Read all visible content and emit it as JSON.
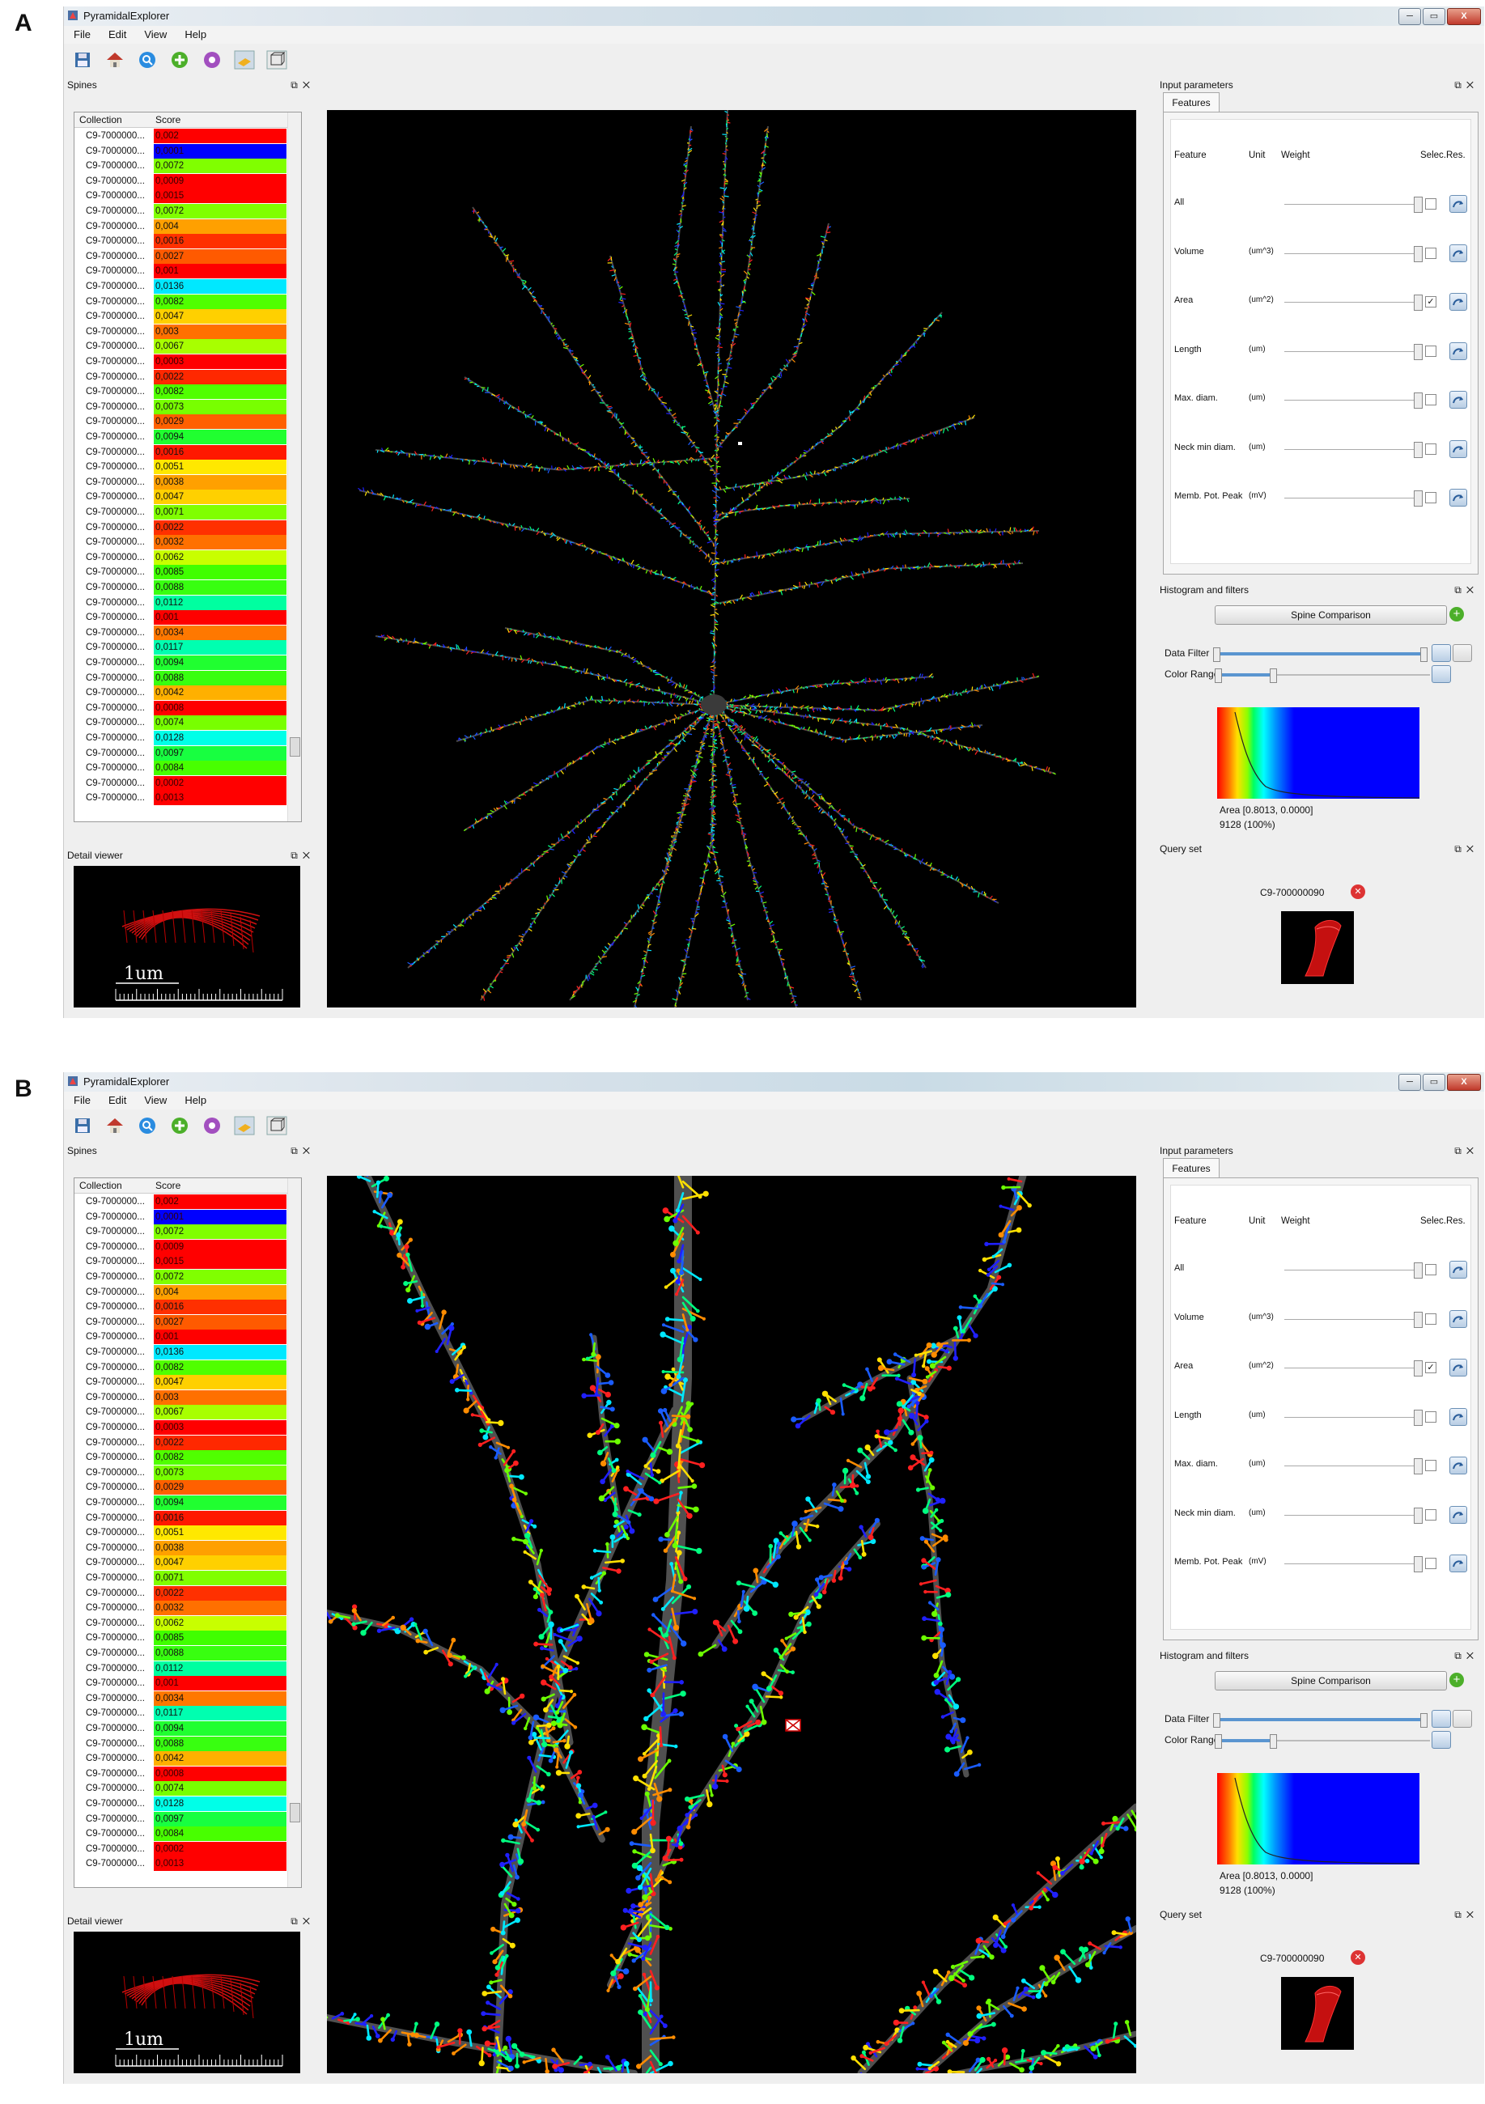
{
  "panels": [
    {
      "letter": "A",
      "window": {
        "title": "PyramidalExplorer",
        "buttons": [
          "─",
          "▭",
          "X"
        ]
      },
      "menu": [
        "File",
        "Edit",
        "View",
        "Help"
      ],
      "spines": {
        "header": "Spines",
        "columns": [
          "Collection",
          "Score"
        ],
        "rows": [
          {
            "c": "C9-7000000...",
            "v": "0,002",
            "color": "#ff0000"
          },
          {
            "c": "C9-7000000...",
            "v": "0,0001",
            "color": "#0000ff"
          },
          {
            "c": "C9-7000000...",
            "v": "0,0072",
            "color": "#80ff00"
          },
          {
            "c": "C9-7000000...",
            "v": "0,0009",
            "color": "#ff0000"
          },
          {
            "c": "C9-7000000...",
            "v": "0,0015",
            "color": "#ff0000"
          },
          {
            "c": "C9-7000000...",
            "v": "0,0072",
            "color": "#80ff00"
          },
          {
            "c": "C9-7000000...",
            "v": "0,004",
            "color": "#ffa000"
          },
          {
            "c": "C9-7000000...",
            "v": "0,0016",
            "color": "#ff3000"
          },
          {
            "c": "C9-7000000...",
            "v": "0,0027",
            "color": "#ff5a00"
          },
          {
            "c": "C9-7000000...",
            "v": "0,001",
            "color": "#ff0000"
          },
          {
            "c": "C9-7000000...",
            "v": "0,0136",
            "color": "#00e8ff"
          },
          {
            "c": "C9-7000000...",
            "v": "0,0082",
            "color": "#50ff00"
          },
          {
            "c": "C9-7000000...",
            "v": "0,0047",
            "color": "#ffd000"
          },
          {
            "c": "C9-7000000...",
            "v": "0,003",
            "color": "#ff7000"
          },
          {
            "c": "C9-7000000...",
            "v": "0,0067",
            "color": "#a8ff00"
          },
          {
            "c": "C9-7000000...",
            "v": "0,0003",
            "color": "#ff0000"
          },
          {
            "c": "C9-7000000...",
            "v": "0,0022",
            "color": "#ff2800"
          },
          {
            "c": "C9-7000000...",
            "v": "0,0082",
            "color": "#50ff00"
          },
          {
            "c": "C9-7000000...",
            "v": "0,0073",
            "color": "#78ff00"
          },
          {
            "c": "C9-7000000...",
            "v": "0,0029",
            "color": "#ff6000"
          },
          {
            "c": "C9-7000000...",
            "v": "0,0094",
            "color": "#20ff30"
          },
          {
            "c": "C9-7000000...",
            "v": "0,0016",
            "color": "#ff1800"
          },
          {
            "c": "C9-7000000...",
            "v": "0,0051",
            "color": "#ffe800"
          },
          {
            "c": "C9-7000000...",
            "v": "0,0038",
            "color": "#ffa000"
          },
          {
            "c": "C9-7000000...",
            "v": "0,0047",
            "color": "#ffd000"
          },
          {
            "c": "C9-7000000...",
            "v": "0,0071",
            "color": "#80ff00"
          },
          {
            "c": "C9-7000000...",
            "v": "0,0022",
            "color": "#ff3000"
          },
          {
            "c": "C9-7000000...",
            "v": "0,0032",
            "color": "#ff7000"
          },
          {
            "c": "C9-7000000...",
            "v": "0,0062",
            "color": "#c8ff00"
          },
          {
            "c": "C9-7000000...",
            "v": "0,0085",
            "color": "#40ff00"
          },
          {
            "c": "C9-7000000...",
            "v": "0,0088",
            "color": "#38ff10"
          },
          {
            "c": "C9-7000000...",
            "v": "0,0112",
            "color": "#00ffa0"
          },
          {
            "c": "C9-7000000...",
            "v": "0,001",
            "color": "#ff0000"
          },
          {
            "c": "C9-7000000...",
            "v": "0,0034",
            "color": "#ff7800"
          },
          {
            "c": "C9-7000000...",
            "v": "0,0117",
            "color": "#00ffb0"
          },
          {
            "c": "C9-7000000...",
            "v": "0,0094",
            "color": "#20ff30"
          },
          {
            "c": "C9-7000000...",
            "v": "0,0088",
            "color": "#38ff10"
          },
          {
            "c": "C9-7000000...",
            "v": "0,0042",
            "color": "#ffb000"
          },
          {
            "c": "C9-7000000...",
            "v": "0,0008",
            "color": "#ff0000"
          },
          {
            "c": "C9-7000000...",
            "v": "0,0074",
            "color": "#78ff00"
          },
          {
            "c": "C9-7000000...",
            "v": "0,0128",
            "color": "#00ffe8"
          },
          {
            "c": "C9-7000000...",
            "v": "0,0097",
            "color": "#18ff40"
          },
          {
            "c": "C9-7000000...",
            "v": "0,0084",
            "color": "#48ff00"
          },
          {
            "c": "C9-7000000...",
            "v": "0,0002",
            "color": "#ff0000"
          },
          {
            "c": "C9-7000000...",
            "v": "0,0013",
            "color": "#ff0000"
          }
        ]
      },
      "detail": {
        "header": "Detail viewer",
        "scale": "1um"
      },
      "input": {
        "header": "Input parameters",
        "tab": "Features",
        "cols": [
          "Feature",
          "Unit",
          "Weight",
          "Selec.",
          "Res."
        ],
        "features": [
          {
            "name": "All",
            "unit": "",
            "checked": false
          },
          {
            "name": "Volume",
            "unit": "(um^3)",
            "checked": false
          },
          {
            "name": "Area",
            "unit": "(um^2)",
            "checked": true
          },
          {
            "name": "Length",
            "unit": "(um)",
            "checked": false
          },
          {
            "name": "Max. diam.",
            "unit": "(um)",
            "checked": false
          },
          {
            "name": "Neck min diam.",
            "unit": "(um)",
            "checked": false
          },
          {
            "name": "Memb. Pot. Peak",
            "unit": "(mV)",
            "checked": false
          }
        ]
      },
      "histogram": {
        "header": "Histogram and filters",
        "button": "Spine Comparison",
        "data_filter": "Data Filter",
        "color_range": "Color Range",
        "caption1": "Area [0.8013, 0.0000]",
        "caption2": "9128 (100%)"
      },
      "query": {
        "header": "Query set",
        "id": "C9-700000090"
      },
      "zoom": false
    },
    {
      "letter": "B",
      "window": {
        "title": "PyramidalExplorer",
        "buttons": [
          "─",
          "▭",
          "X"
        ]
      },
      "menu": [
        "File",
        "Edit",
        "View",
        "Help"
      ],
      "spines": {
        "header": "Spines",
        "columns": [
          "Collection",
          "Score"
        ],
        "rows": [
          {
            "c": "C9-7000000...",
            "v": "0,002",
            "color": "#ff0000"
          },
          {
            "c": "C9-7000000...",
            "v": "0,0001",
            "color": "#0000ff"
          },
          {
            "c": "C9-7000000...",
            "v": "0,0072",
            "color": "#80ff00"
          },
          {
            "c": "C9-7000000...",
            "v": "0,0009",
            "color": "#ff0000"
          },
          {
            "c": "C9-7000000...",
            "v": "0,0015",
            "color": "#ff0000"
          },
          {
            "c": "C9-7000000...",
            "v": "0,0072",
            "color": "#80ff00"
          },
          {
            "c": "C9-7000000...",
            "v": "0,004",
            "color": "#ffa000"
          },
          {
            "c": "C9-7000000...",
            "v": "0,0016",
            "color": "#ff3000"
          },
          {
            "c": "C9-7000000...",
            "v": "0,0027",
            "color": "#ff5a00"
          },
          {
            "c": "C9-7000000...",
            "v": "0,001",
            "color": "#ff0000"
          },
          {
            "c": "C9-7000000...",
            "v": "0,0136",
            "color": "#00e8ff"
          },
          {
            "c": "C9-7000000...",
            "v": "0,0082",
            "color": "#50ff00"
          },
          {
            "c": "C9-7000000...",
            "v": "0,0047",
            "color": "#ffd000"
          },
          {
            "c": "C9-7000000...",
            "v": "0,003",
            "color": "#ff7000"
          },
          {
            "c": "C9-7000000...",
            "v": "0,0067",
            "color": "#a8ff00"
          },
          {
            "c": "C9-7000000...",
            "v": "0,0003",
            "color": "#ff0000"
          },
          {
            "c": "C9-7000000...",
            "v": "0,0022",
            "color": "#ff2800"
          },
          {
            "c": "C9-7000000...",
            "v": "0,0082",
            "color": "#50ff00"
          },
          {
            "c": "C9-7000000...",
            "v": "0,0073",
            "color": "#78ff00"
          },
          {
            "c": "C9-7000000...",
            "v": "0,0029",
            "color": "#ff6000"
          },
          {
            "c": "C9-7000000...",
            "v": "0,0094",
            "color": "#20ff30"
          },
          {
            "c": "C9-7000000...",
            "v": "0,0016",
            "color": "#ff1800"
          },
          {
            "c": "C9-7000000...",
            "v": "0,0051",
            "color": "#ffe800"
          },
          {
            "c": "C9-7000000...",
            "v": "0,0038",
            "color": "#ffa000"
          },
          {
            "c": "C9-7000000...",
            "v": "0,0047",
            "color": "#ffd000"
          },
          {
            "c": "C9-7000000...",
            "v": "0,0071",
            "color": "#80ff00"
          },
          {
            "c": "C9-7000000...",
            "v": "0,0022",
            "color": "#ff3000"
          },
          {
            "c": "C9-7000000...",
            "v": "0,0032",
            "color": "#ff7000"
          },
          {
            "c": "C9-7000000...",
            "v": "0,0062",
            "color": "#c8ff00"
          },
          {
            "c": "C9-7000000...",
            "v": "0,0085",
            "color": "#40ff00"
          },
          {
            "c": "C9-7000000...",
            "v": "0,0088",
            "color": "#38ff10"
          },
          {
            "c": "C9-7000000...",
            "v": "0,0112",
            "color": "#00ffa0"
          },
          {
            "c": "C9-7000000...",
            "v": "0,001",
            "color": "#ff0000"
          },
          {
            "c": "C9-7000000...",
            "v": "0,0034",
            "color": "#ff7800"
          },
          {
            "c": "C9-7000000...",
            "v": "0,0117",
            "color": "#00ffb0"
          },
          {
            "c": "C9-7000000...",
            "v": "0,0094",
            "color": "#20ff30"
          },
          {
            "c": "C9-7000000...",
            "v": "0,0088",
            "color": "#38ff10"
          },
          {
            "c": "C9-7000000...",
            "v": "0,0042",
            "color": "#ffb000"
          },
          {
            "c": "C9-7000000...",
            "v": "0,0008",
            "color": "#ff0000"
          },
          {
            "c": "C9-7000000...",
            "v": "0,0074",
            "color": "#78ff00"
          },
          {
            "c": "C9-7000000...",
            "v": "0,0128",
            "color": "#00ffe8"
          },
          {
            "c": "C9-7000000...",
            "v": "0,0097",
            "color": "#18ff40"
          },
          {
            "c": "C9-7000000...",
            "v": "0,0084",
            "color": "#48ff00"
          },
          {
            "c": "C9-7000000...",
            "v": "0,0002",
            "color": "#ff0000"
          },
          {
            "c": "C9-7000000...",
            "v": "0,0013",
            "color": "#ff0000"
          }
        ]
      },
      "detail": {
        "header": "Detail viewer",
        "scale": "1um"
      },
      "input": {
        "header": "Input parameters",
        "tab": "Features",
        "cols": [
          "Feature",
          "Unit",
          "Weight",
          "Selec.",
          "Res."
        ],
        "features": [
          {
            "name": "All",
            "unit": "",
            "checked": false
          },
          {
            "name": "Volume",
            "unit": "(um^3)",
            "checked": false
          },
          {
            "name": "Area",
            "unit": "(um^2)",
            "checked": true
          },
          {
            "name": "Length",
            "unit": "(um)",
            "checked": false
          },
          {
            "name": "Max. diam.",
            "unit": "(um)",
            "checked": false
          },
          {
            "name": "Neck min diam.",
            "unit": "(um)",
            "checked": false
          },
          {
            "name": "Memb. Pot. Peak",
            "unit": "(mV)",
            "checked": false
          }
        ]
      },
      "histogram": {
        "header": "Histogram and filters",
        "button": "Spine Comparison",
        "data_filter": "Data Filter",
        "color_range": "Color Range",
        "caption1": "Area [0.8013, 0.0000]",
        "caption2": "9128 (100%)"
      },
      "query": {
        "header": "Query set",
        "id": "C9-700000090"
      },
      "zoom": true
    }
  ]
}
